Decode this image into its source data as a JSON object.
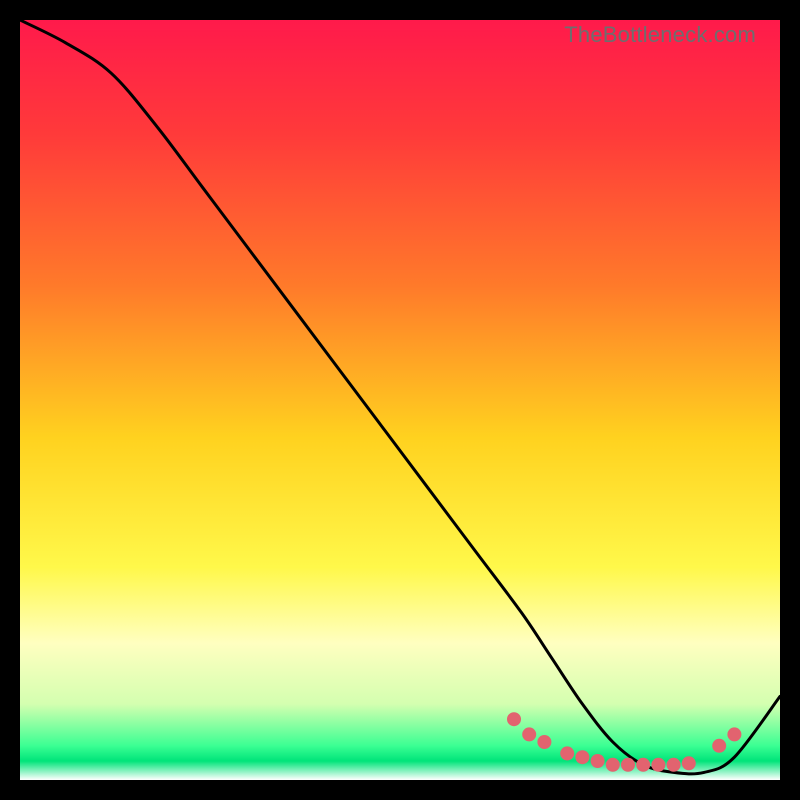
{
  "watermark": "TheBottleneck.com",
  "chart_data": {
    "type": "line",
    "title": "",
    "xlabel": "",
    "ylabel": "",
    "xlim": [
      0,
      100
    ],
    "ylim": [
      0,
      100
    ],
    "grid": false,
    "legend": false,
    "gradient_stops": [
      {
        "offset": 0.0,
        "color": "#ff1a4b"
      },
      {
        "offset": 0.15,
        "color": "#ff3a3a"
      },
      {
        "offset": 0.35,
        "color": "#ff7a2a"
      },
      {
        "offset": 0.55,
        "color": "#ffd21f"
      },
      {
        "offset": 0.72,
        "color": "#fff84a"
      },
      {
        "offset": 0.82,
        "color": "#ffffc0"
      },
      {
        "offset": 0.9,
        "color": "#d4ffb0"
      },
      {
        "offset": 0.955,
        "color": "#3bff93"
      },
      {
        "offset": 0.975,
        "color": "#00e47a"
      },
      {
        "offset": 1.0,
        "color": "#ffffff"
      }
    ],
    "series": [
      {
        "name": "bottleneck-curve",
        "x": [
          0,
          6,
          12,
          18,
          24,
          30,
          36,
          42,
          48,
          54,
          60,
          66,
          70,
          74,
          78,
          82,
          86,
          90,
          94,
          100
        ],
        "y": [
          100,
          97,
          93,
          86,
          78,
          70,
          62,
          54,
          46,
          38,
          30,
          22,
          16,
          10,
          5,
          2,
          1,
          1,
          3,
          11
        ]
      }
    ],
    "markers": {
      "name": "highlight-dots",
      "color": "#e2636f",
      "radius": 7,
      "points_x": [
        65,
        67,
        69,
        72,
        74,
        76,
        78,
        80,
        82,
        84,
        86,
        88,
        92,
        94
      ],
      "points_y": [
        8,
        6,
        5,
        3.5,
        3,
        2.5,
        2,
        2,
        2,
        2,
        2,
        2.2,
        4.5,
        6
      ]
    }
  }
}
